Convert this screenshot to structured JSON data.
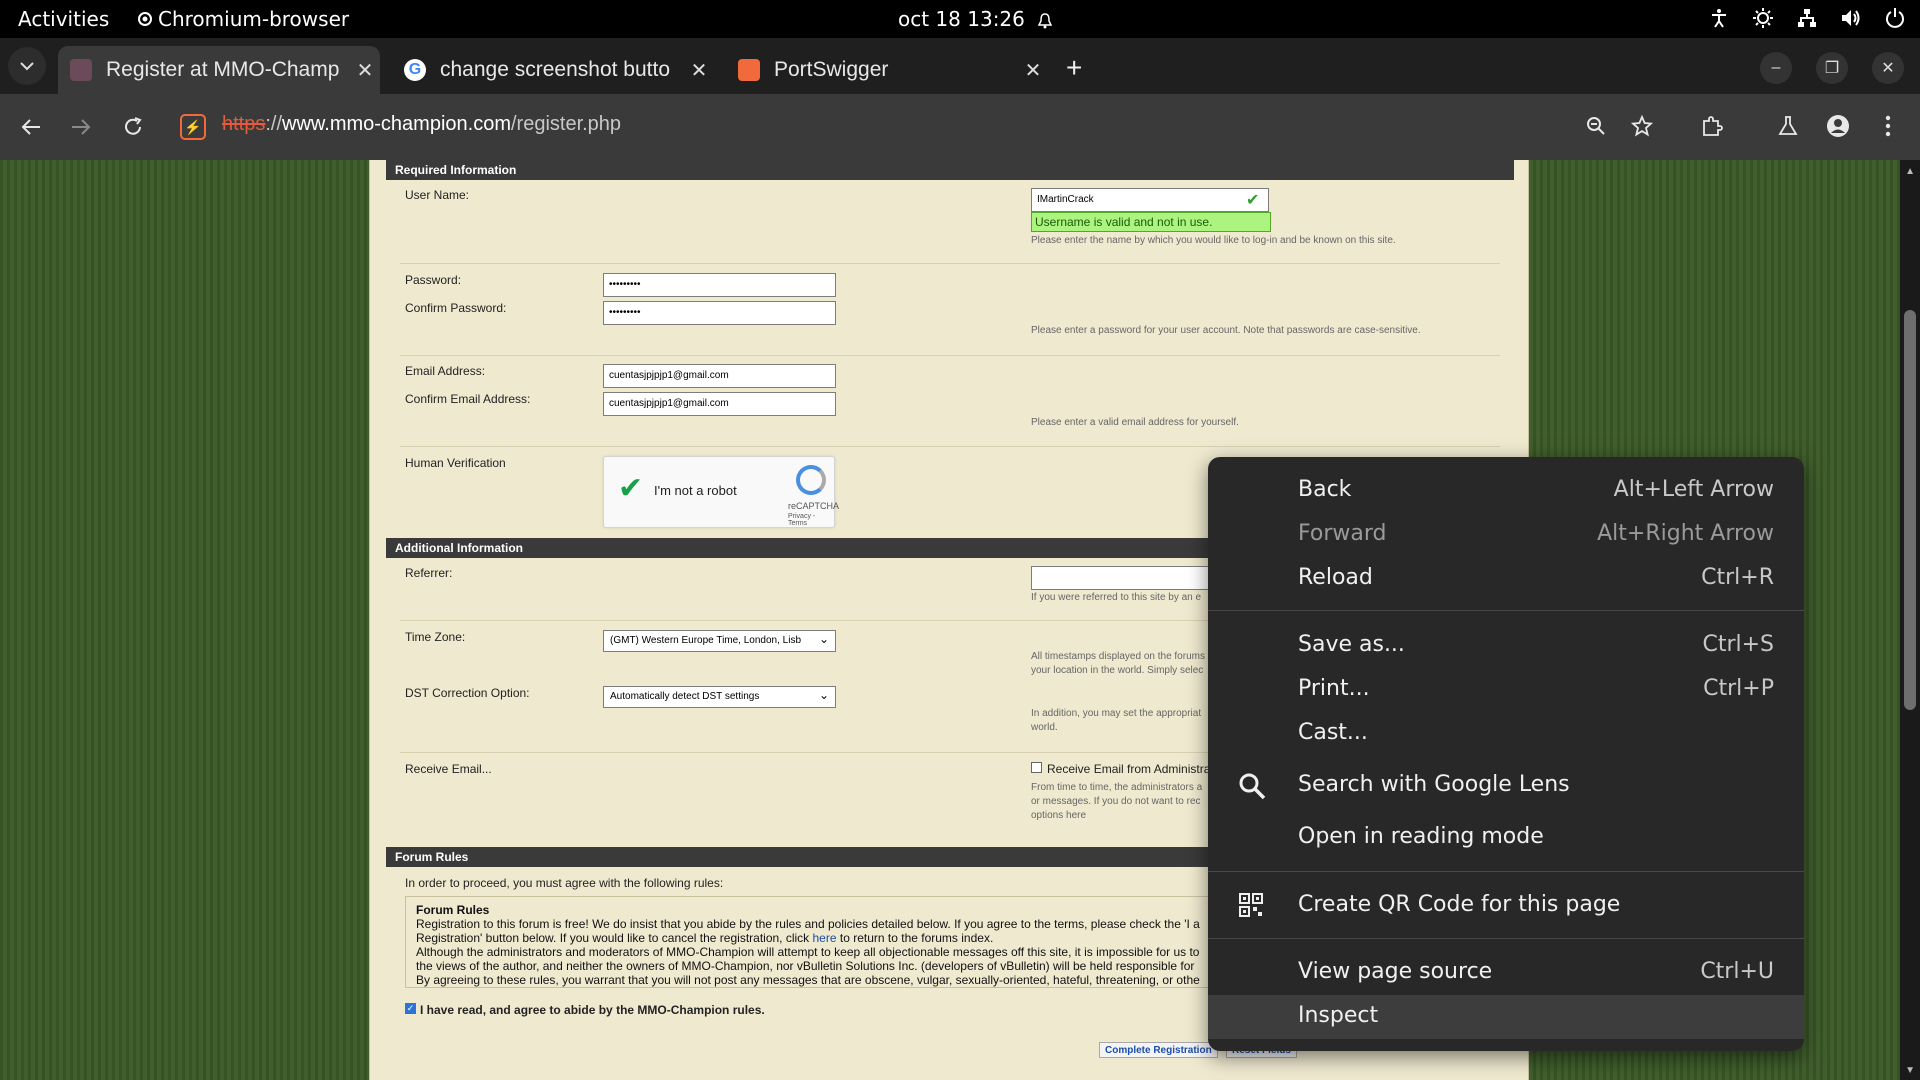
{
  "system_bar": {
    "activities": "Activities",
    "app_name": "Chromium-browser",
    "clock": "oct 18  13:26"
  },
  "tabs": [
    {
      "title": "Register at MMO-Champ",
      "favicon_color": "#6b4a5a",
      "active": true
    },
    {
      "title": "change screenshot butto",
      "favicon_color": "#ffffff",
      "active": false
    },
    {
      "title": "PortSwigger",
      "favicon_color": "#f06a3c",
      "active": false
    }
  ],
  "toolbar": {
    "url_proto": "https",
    "url_sep": "://",
    "url_host": "www.mmo-champion.com",
    "url_path": "/register.php"
  },
  "form": {
    "required_header": "Required Information",
    "username_label": "User Name:",
    "username_value": "IMartinCrack",
    "username_valid": "Username is valid and not in use.",
    "username_hint": "Please enter the name by which you would like to log-in and be known on this site.",
    "password_label": "Password:",
    "password_value": "•••••••••",
    "confirm_password_label": "Confirm Password:",
    "confirm_password_value": "•••••••••",
    "password_hint": "Please enter a password for your user account. Note that passwords are case-sensitive.",
    "email_label": "Email Address:",
    "email_value": "cuentasjpjpjp1@gmail.com",
    "confirm_email_label": "Confirm Email Address:",
    "confirm_email_value": "cuentasjpjpjp1@gmail.com",
    "email_hint": "Please enter a valid email address for yourself.",
    "human_label": "Human Verification",
    "recaptcha_text": "I'm not a robot",
    "recaptcha_brand": "reCAPTCHA",
    "recaptcha_links": "Privacy - Terms",
    "additional_header": "Additional Information",
    "referrer_label": "Referrer:",
    "referrer_hint": "If you were referred to this site by an e",
    "timezone_label": "Time Zone:",
    "timezone_value": "(GMT) Western Europe Time, London, Lisb",
    "timezone_hint_1": "All timestamps displayed on the forums",
    "timezone_hint_2": "your location in the world. Simply selec",
    "dst_label": "DST Correction Option:",
    "dst_value": "Automatically detect DST settings",
    "dst_hint_1": "In addition, you may set the appropriat",
    "dst_hint_2": "world.",
    "receive_label": "Receive Email...",
    "receive_admin": "Receive Email from Administra",
    "receive_hint_1": "From time to time, the administrators a",
    "receive_hint_2": "or messages. If you do not want to rec",
    "receive_hint_3": "options here",
    "rules_header": "Forum Rules",
    "rules_intro": "In order to proceed, you must agree with the following rules:",
    "rules_title": "Forum Rules",
    "rules_line1": "Registration to this forum is free! We do insist that you abide by the rules and policies detailed below. If you agree to the terms, please check the 'I a",
    "rules_line2a": "Registration' button below. If you would like to cancel the registration, click ",
    "rules_link": "here",
    "rules_line2b": " to return to the forums index.",
    "rules_line3": "Although the administrators and moderators of MMO-Champion will attempt to keep all objectionable messages off this site, it is impossible for us to",
    "rules_line4": "the views of the author, and neither the owners of MMO-Champion, nor vBulletin Solutions Inc. (developers of vBulletin) will be held responsible for",
    "rules_line5": "By agreeing to these rules, you warrant that you will not post any messages that are obscene, vulgar, sexually-oriented, hateful, threatening, or othe",
    "agree_label": "I have read, and agree to abide by the MMO-Champion rules.",
    "complete_button": "Complete Registration",
    "reset_button": "Reset Fields"
  },
  "context_menu": [
    {
      "label": "Back",
      "shortcut": "Alt+Left Arrow"
    },
    {
      "label": "Forward",
      "shortcut": "Alt+Right Arrow"
    },
    {
      "label": "Reload",
      "shortcut": "Ctrl+R"
    },
    {
      "label": "Save as...",
      "shortcut": "Ctrl+S"
    },
    {
      "label": "Print...",
      "shortcut": "Ctrl+P"
    },
    {
      "label": "Cast...",
      "shortcut": ""
    },
    {
      "label": "Search with Google Lens",
      "shortcut": ""
    },
    {
      "label": "Open in reading mode",
      "shortcut": ""
    },
    {
      "label": "Create QR Code for this page",
      "shortcut": ""
    },
    {
      "label": "View page source",
      "shortcut": "Ctrl+U"
    },
    {
      "label": "Inspect",
      "shortcut": ""
    }
  ]
}
